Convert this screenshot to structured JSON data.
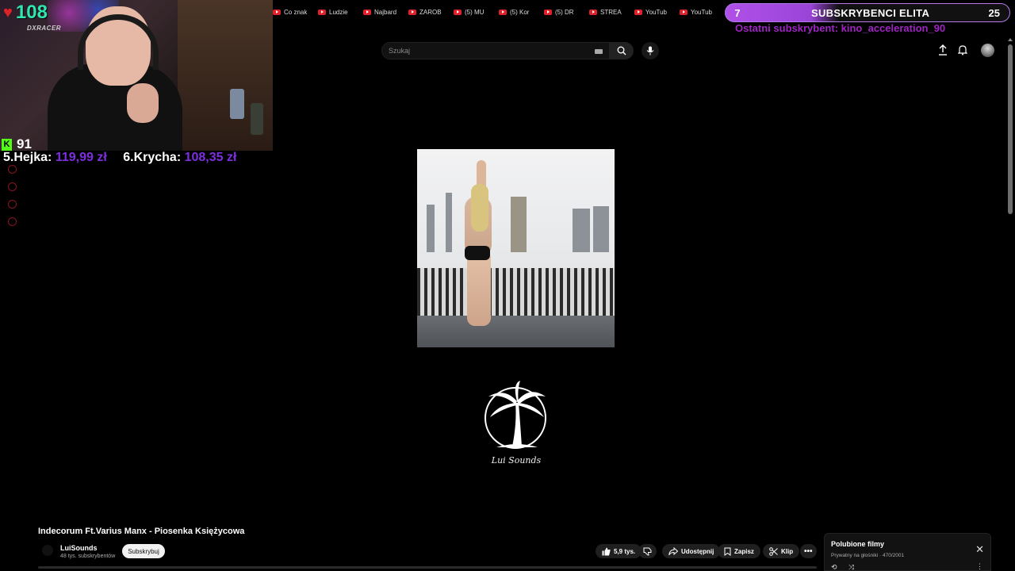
{
  "bookmarks": [
    "Co znak",
    "Ludzie",
    "Najbard",
    "ZAROB",
    "(5) MU",
    "(5) Kor",
    "(5) DR",
    "STREA",
    "YouTub",
    "YouTub"
  ],
  "overlay": {
    "hearts": "108",
    "kick_count": "91",
    "cam_brand": "DXRACER",
    "donors": [
      {
        "rank_name": "5.Hejka:",
        "amount": "119,99 zł"
      },
      {
        "rank_name": "6.Krycha:",
        "amount": "108,35 zł"
      }
    ],
    "sub_goal": {
      "current": "7",
      "title": "SUBSKRYBENCI ELITA",
      "goal": "25",
      "progress": 0.28
    },
    "last_sub": "Ostatni subskrybent: kino_acceleration_90"
  },
  "search": {
    "placeholder": "Szukaj"
  },
  "video": {
    "title": "Indecorum Ft.Varius Manx - Piosenka Księżycowa",
    "logo_text": "Lui Sounds"
  },
  "channel": {
    "name": "LuiSounds",
    "subs": "48 tys. subskrybentów",
    "subscribe_label": "Subskrybuj"
  },
  "actions": {
    "likes": "5,9 tys.",
    "share": "Udostępnij",
    "save": "Zapisz",
    "clip": "Klip"
  },
  "playlist": {
    "title": "Polubione filmy",
    "meta": "Prywatny na głośniki · 470/2001"
  },
  "colors": {
    "accent_purple": "#9a44d8",
    "youtube_red": "#e0212a",
    "kick_green": "#53fc18",
    "donation_purple": "#7d2fe0",
    "hearts_teal": "#2fe6b0"
  }
}
